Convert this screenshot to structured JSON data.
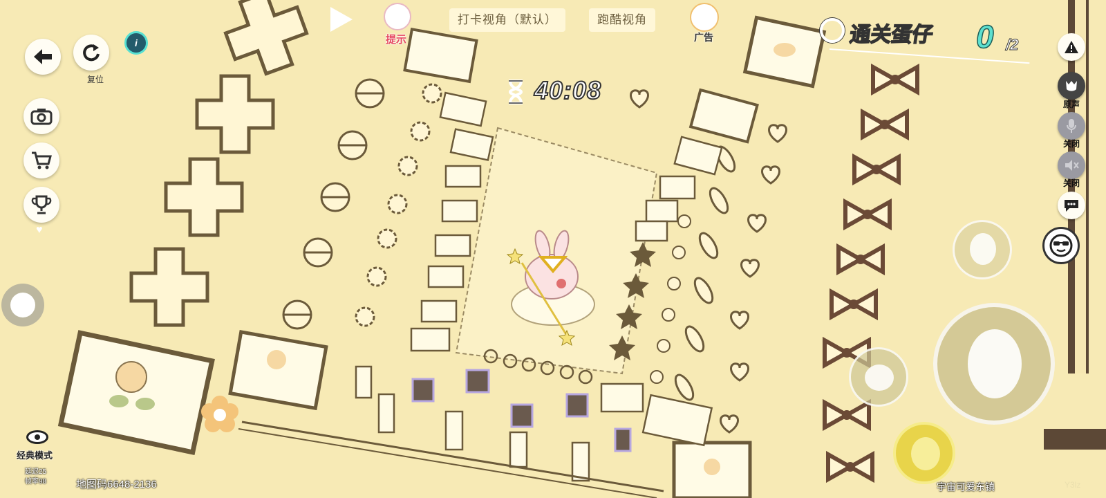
{
  "top_bar": {
    "hint_label": "提示",
    "checkin_view_tab": "打卡视角（默认）",
    "parkour_view_tab": "跑酷视角",
    "ad_label": "广告",
    "timer": "40:08",
    "goal_label": "通关蛋仔",
    "goal_current": "0",
    "goal_total": "/2"
  },
  "left_panel": {
    "back_icon": "back-arrow-icon",
    "reset_label": "复位",
    "info_icon": "info-icon",
    "camera_icon": "camera-icon",
    "cart_icon": "cart-icon",
    "trophy_icon": "trophy-icon",
    "eye_icon": "eye-icon",
    "classic_mode_label": "经典模式",
    "latency_line1": "延迟25",
    "latency_line2": "帧率98",
    "map_code_label": "地图码6648-2136"
  },
  "right_panel": {
    "alert_icon": "warning-icon",
    "voice_label": "原声",
    "mic_label": "关闭",
    "speaker_label": "关闭",
    "chat_icon": "chat-bubble-icon",
    "emote_icon": "sunglasses-face-icon",
    "map_name": "宇宙可爱东镇",
    "watermark": "Y3lz"
  },
  "colors": {
    "floor": "#f7eab5",
    "tile_outline": "#6b5a3a",
    "score_accent": "#5ee0cf"
  }
}
